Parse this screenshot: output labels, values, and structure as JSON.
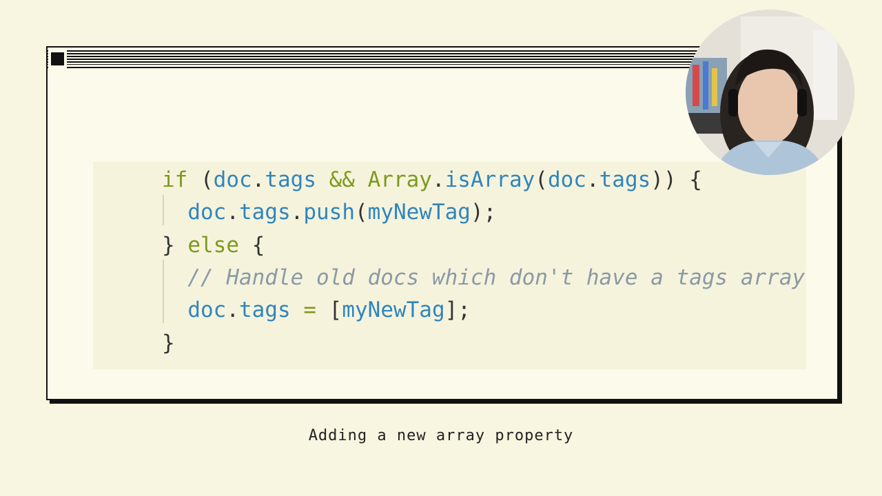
{
  "code": {
    "lines": [
      [
        {
          "t": "if",
          "c": "kw"
        },
        {
          "t": " (",
          "c": "punc"
        },
        {
          "t": "doc",
          "c": "var"
        },
        {
          "t": ".",
          "c": "punc"
        },
        {
          "t": "tags",
          "c": "var"
        },
        {
          "t": " && ",
          "c": "op"
        },
        {
          "t": "Array",
          "c": "kw"
        },
        {
          "t": ".",
          "c": "punc"
        },
        {
          "t": "isArray",
          "c": "fn"
        },
        {
          "t": "(",
          "c": "punc"
        },
        {
          "t": "doc",
          "c": "var"
        },
        {
          "t": ".",
          "c": "punc"
        },
        {
          "t": "tags",
          "c": "var"
        },
        {
          "t": ")) {",
          "c": "punc"
        }
      ],
      [
        {
          "t": "  doc",
          "c": "var"
        },
        {
          "t": ".",
          "c": "punc"
        },
        {
          "t": "tags",
          "c": "var"
        },
        {
          "t": ".",
          "c": "punc"
        },
        {
          "t": "push",
          "c": "fn"
        },
        {
          "t": "(",
          "c": "punc"
        },
        {
          "t": "myNewTag",
          "c": "var"
        },
        {
          "t": ");",
          "c": "punc"
        }
      ],
      [
        {
          "t": "} ",
          "c": "punc"
        },
        {
          "t": "else",
          "c": "kw"
        },
        {
          "t": " {",
          "c": "punc"
        }
      ],
      [
        {
          "t": "  // Handle old docs which don't have a tags array",
          "c": "comment"
        }
      ],
      [
        {
          "t": "  doc",
          "c": "var"
        },
        {
          "t": ".",
          "c": "punc"
        },
        {
          "t": "tags",
          "c": "var"
        },
        {
          "t": " = ",
          "c": "op"
        },
        {
          "t": "[",
          "c": "punc"
        },
        {
          "t": "myNewTag",
          "c": "var"
        },
        {
          "t": "];",
          "c": "punc"
        }
      ],
      [
        {
          "t": "}",
          "c": "punc"
        }
      ]
    ]
  },
  "caption": "Adding a new array property",
  "colors": {
    "background": "#f8f5e0",
    "keyword": "#7d9a1e",
    "identifier": "#2f86bd",
    "comment": "#8a9aa5"
  },
  "icons": {
    "close_box": "close-box-icon",
    "webcam": "presenter-webcam"
  }
}
